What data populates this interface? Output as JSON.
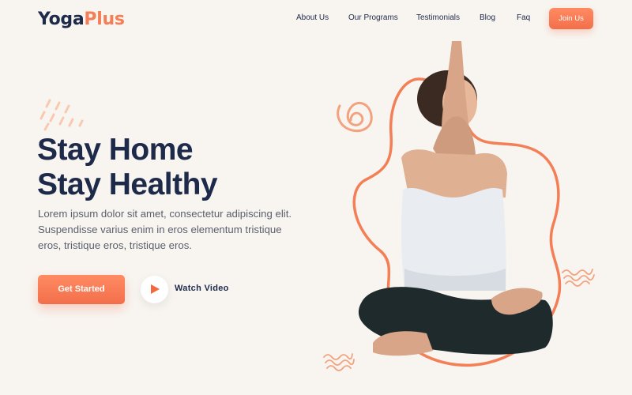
{
  "brand": {
    "name_part1": "Yoga",
    "name_part2": "Plus",
    "accent": "#f47f56",
    "navy": "#1e2a4a"
  },
  "nav": {
    "items": [
      "About Us",
      "Our Programs",
      "Testimonials",
      "Blog",
      "Faq"
    ],
    "join_label": "Join Us"
  },
  "hero": {
    "headline_line1": "Stay Home",
    "headline_line2": "Stay Healthy",
    "body": "Lorem ipsum dolor sit amet, consectetur adipiscing elit. Suspendisse varius enim in eros elementum tristique eros, tristique eros, tristique eros.",
    "cta_label": "Get Started",
    "watch_label": "Watch Video"
  },
  "icons": [
    "play-icon",
    "spiral-icon",
    "squiggle-icon"
  ]
}
